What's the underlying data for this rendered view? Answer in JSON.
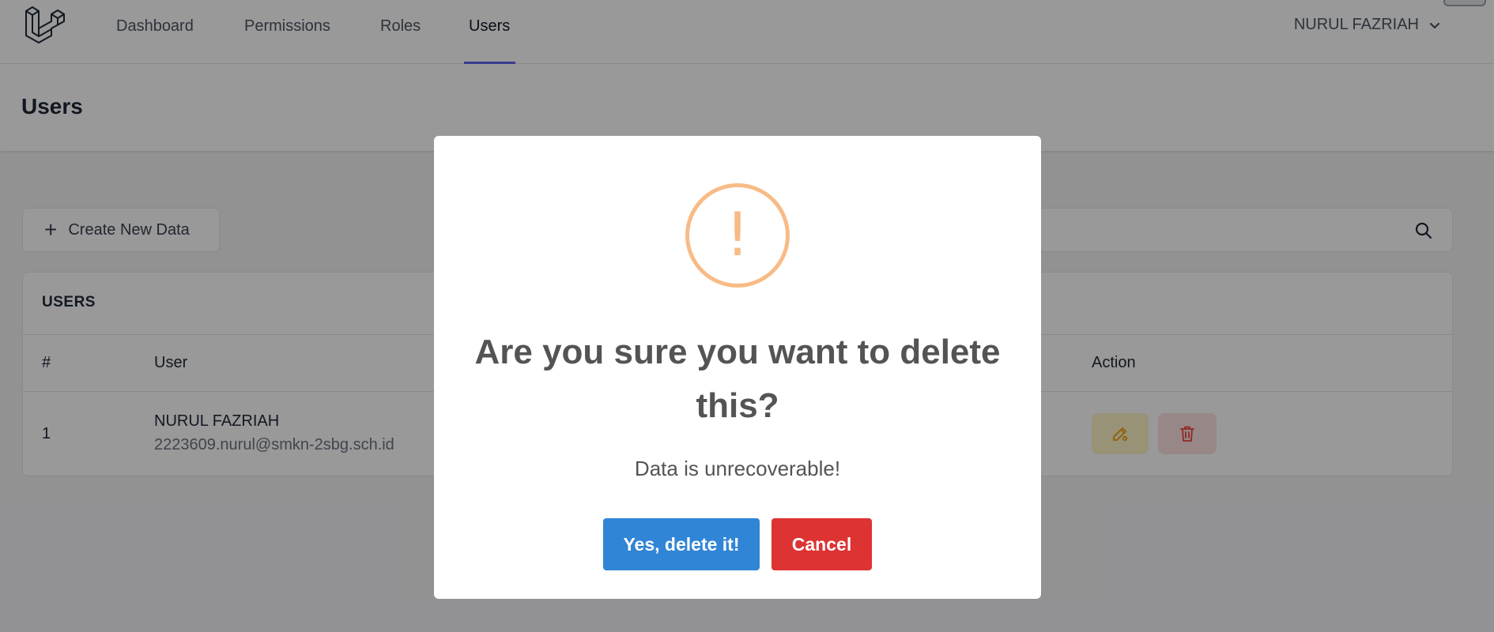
{
  "nav": {
    "items": [
      {
        "label": "Dashboard",
        "active": false
      },
      {
        "label": "Permissions",
        "active": false
      },
      {
        "label": "Roles",
        "active": false
      },
      {
        "label": "Users",
        "active": true
      }
    ],
    "user_name": "NURUL FAZRIAH",
    "accent_color": "#6366f1"
  },
  "page": {
    "title": "Users"
  },
  "toolbar": {
    "create_label": "Create New Data",
    "search_placeholder": ""
  },
  "table": {
    "card_title": "USERS",
    "columns": {
      "index": "#",
      "user": "User",
      "action": "Action"
    },
    "rows": [
      {
        "index": "1",
        "name": "NURUL FAZRIAH",
        "email": "2223609.nurul@smkn-2sbg.sch.id"
      }
    ]
  },
  "modal": {
    "icon": "warning-icon",
    "icon_glyph": "!",
    "icon_color": "#f8bb86",
    "title": "Are you sure you want to delete this?",
    "text": "Data is unrecoverable!",
    "confirm_label": "Yes, delete it!",
    "confirm_color": "#3085d6",
    "cancel_label": "Cancel",
    "cancel_color": "#dd3333"
  }
}
